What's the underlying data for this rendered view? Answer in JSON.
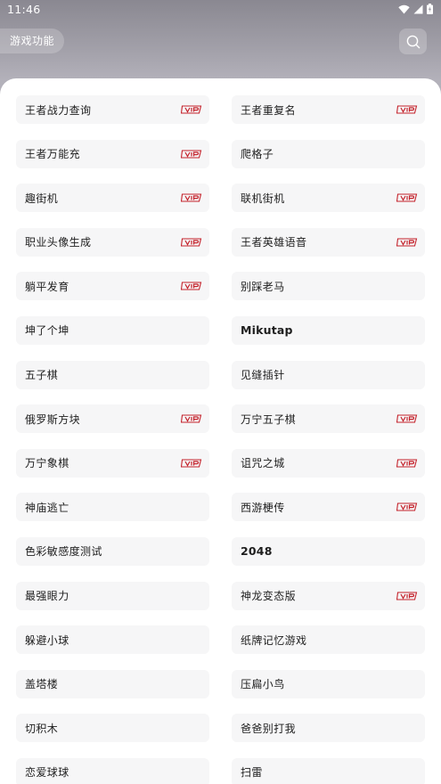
{
  "status_bar": {
    "time": "11:46"
  },
  "header": {
    "feature_label": "游戏功能"
  },
  "colors": {
    "vip_red": "#c4222b",
    "card_bg": "#f6f6f7",
    "header_grad_top": "#8a8891"
  },
  "games": [
    {
      "label": "王者战力查询",
      "vip": true
    },
    {
      "label": "王者重复名",
      "vip": true
    },
    {
      "label": "王者万能充",
      "vip": true
    },
    {
      "label": "爬格子",
      "vip": false
    },
    {
      "label": "趣街机",
      "vip": true
    },
    {
      "label": "联机街机",
      "vip": true
    },
    {
      "label": "职业头像生成",
      "vip": true
    },
    {
      "label": "王者英雄语音",
      "vip": true
    },
    {
      "label": "躺平发育",
      "vip": true
    },
    {
      "label": "别踩老马",
      "vip": false
    },
    {
      "label": "坤了个坤",
      "vip": false
    },
    {
      "label": "Mikutap",
      "vip": false
    },
    {
      "label": "五子棋",
      "vip": false
    },
    {
      "label": "见缝插针",
      "vip": false
    },
    {
      "label": "俄罗斯方块",
      "vip": true
    },
    {
      "label": "万宁五子棋",
      "vip": true
    },
    {
      "label": "万宁象棋",
      "vip": true
    },
    {
      "label": "诅咒之城",
      "vip": true
    },
    {
      "label": "神庙逃亡",
      "vip": false
    },
    {
      "label": "西游梗传",
      "vip": true
    },
    {
      "label": "色彩敏感度测试",
      "vip": false
    },
    {
      "label": "2048",
      "vip": false
    },
    {
      "label": "最强眼力",
      "vip": false
    },
    {
      "label": "神龙变态版",
      "vip": true
    },
    {
      "label": "躲避小球",
      "vip": false
    },
    {
      "label": "纸牌记忆游戏",
      "vip": false
    },
    {
      "label": "盖塔楼",
      "vip": false
    },
    {
      "label": "压扁小鸟",
      "vip": false
    },
    {
      "label": "切积木",
      "vip": false
    },
    {
      "label": "爸爸别打我",
      "vip": false
    },
    {
      "label": "恋爱球球",
      "vip": false
    },
    {
      "label": "扫雷",
      "vip": false
    }
  ]
}
